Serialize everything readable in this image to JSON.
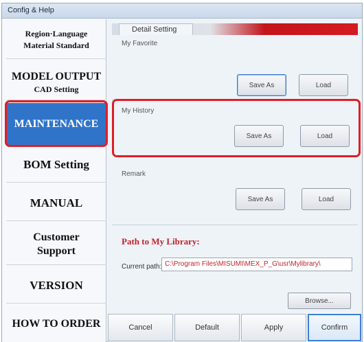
{
  "window": {
    "title": "Config & Help"
  },
  "sidebar": {
    "region_language": "Region·Language",
    "material_standard": "Material Standard",
    "model_output": "MODEL OUTPUT",
    "cad_setting": "CAD Setting",
    "maintenance": "MAINTENANCE",
    "bom_setting": "BOM Setting",
    "manual": "MANUAL",
    "customer_support_line1": "Customer",
    "customer_support_line2": "Support",
    "version": "VERSION",
    "how_to_order": "HOW TO ORDER",
    "active_item": "MAINTENANCE"
  },
  "content": {
    "tab_label": "Detail Setting",
    "my_favorite": {
      "label": "My Favorite",
      "save_as": "Save As",
      "load": "Load"
    },
    "my_history": {
      "label": "My History",
      "save_as": "Save As",
      "load": "Load"
    },
    "remark": {
      "label": "Remark",
      "save_as": "Save As",
      "load": "Load"
    },
    "path_title": "Path to My Library:",
    "current_path_label": "Current path:",
    "current_path_value": "C:\\Program Files\\MISUMI\\MEX_P_G\\usr\\Mylibrary\\",
    "browse": "Browse..."
  },
  "footer": {
    "cancel": "Cancel",
    "default": "Default",
    "apply": "Apply",
    "confirm": "Confirm"
  },
  "colors": {
    "accent_blue": "#2f74c9",
    "highlight_red": "#e01e25",
    "path_red": "#c0232b"
  }
}
